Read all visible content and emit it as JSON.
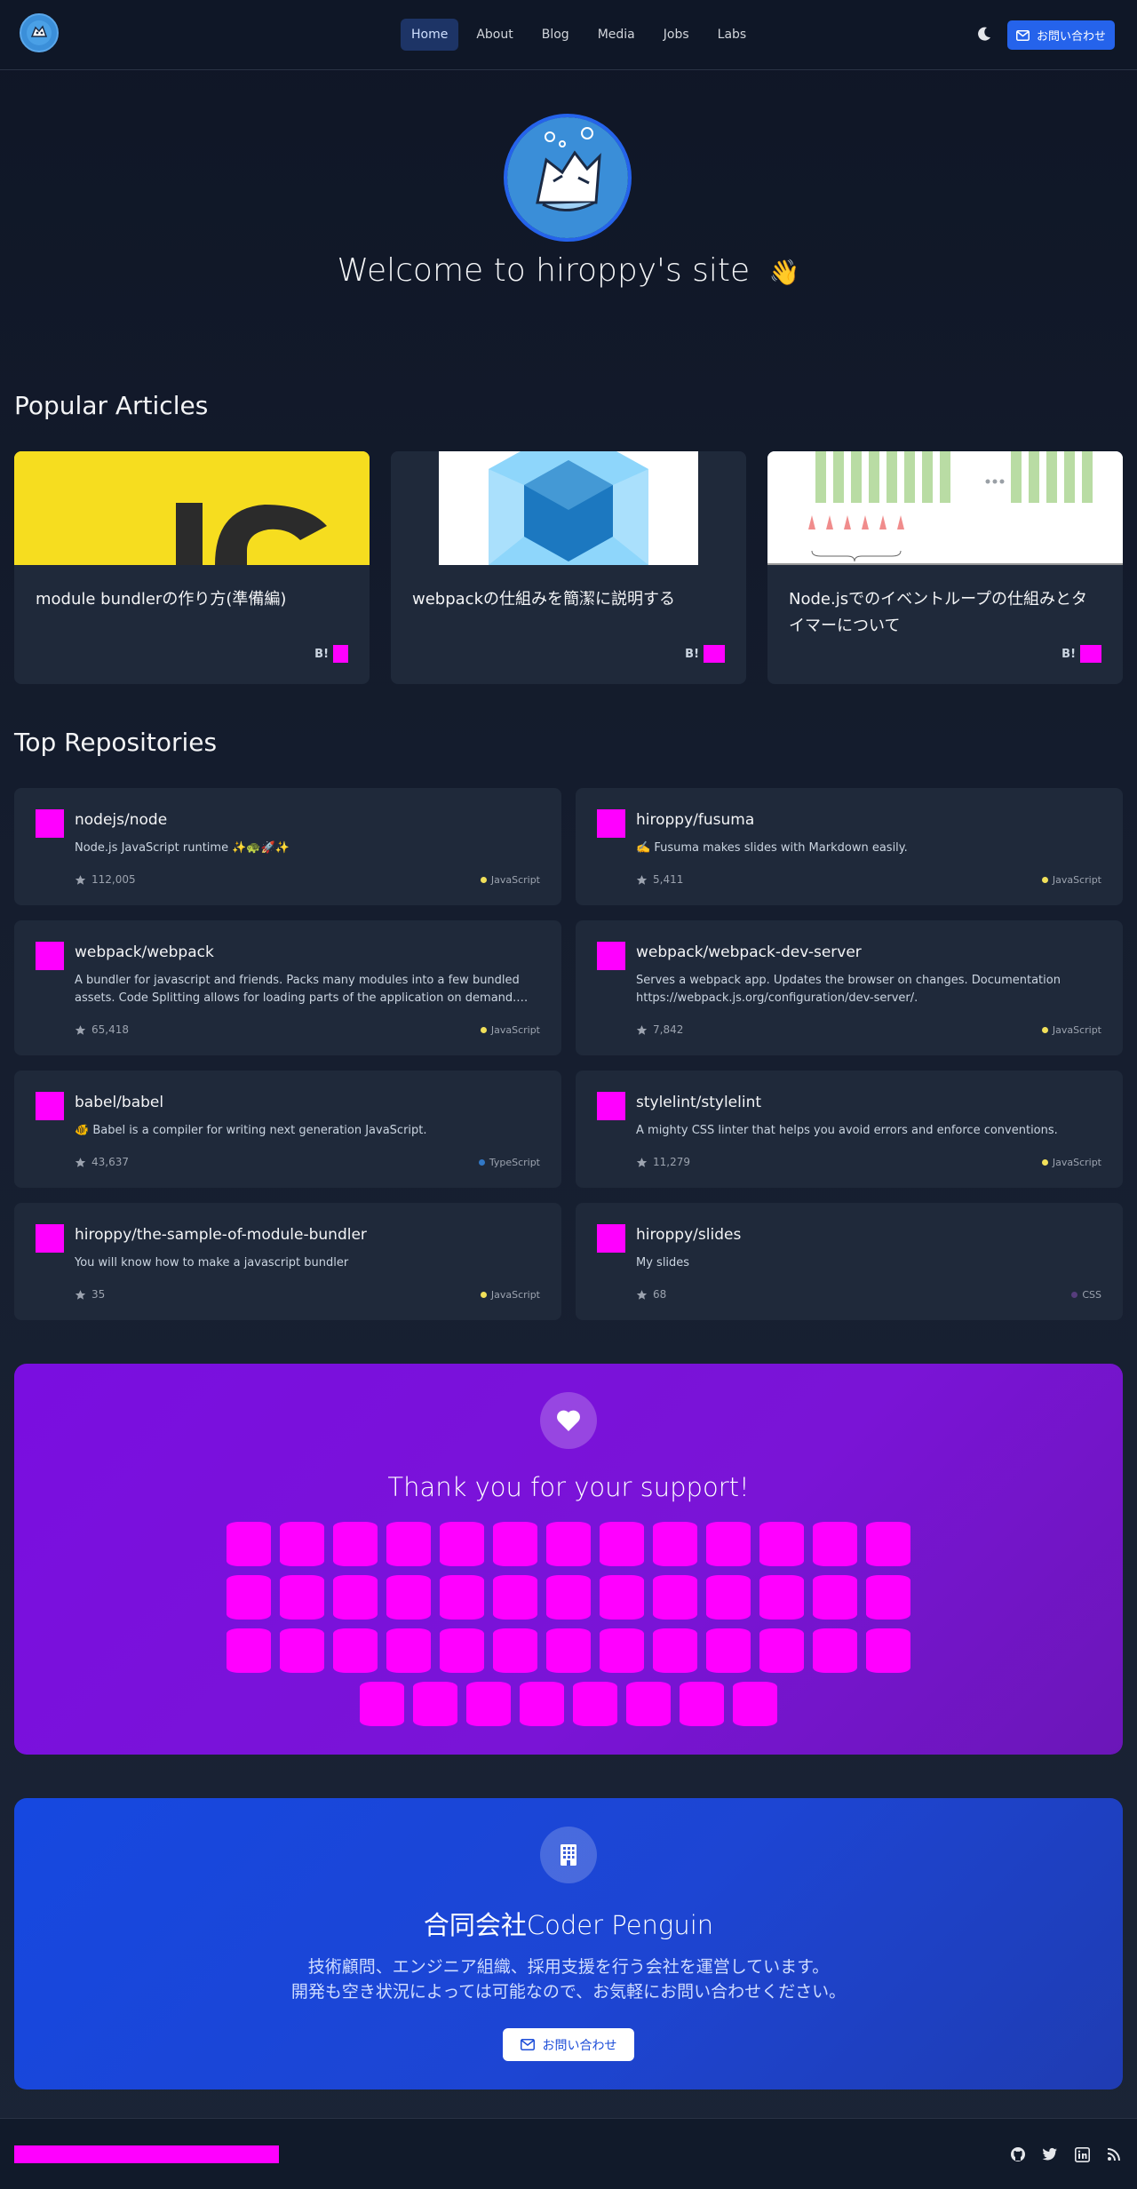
{
  "header": {
    "nav": [
      {
        "label": "Home",
        "active": true
      },
      {
        "label": "About"
      },
      {
        "label": "Blog"
      },
      {
        "label": "Media"
      },
      {
        "label": "Jobs"
      },
      {
        "label": "Labs"
      }
    ],
    "contact_label": "お問い合わせ",
    "icons": {
      "theme": "moon-icon",
      "contact": "mail-icon"
    }
  },
  "hero": {
    "title": "Welcome to hiroppy's site",
    "emoji": "👋"
  },
  "articles": {
    "title": "Popular Articles",
    "items": [
      {
        "title": "module bundlerの作り方(準備編)",
        "badge": "B!"
      },
      {
        "title": "webpackの仕組みを簡潔に説明する",
        "badge": "B!"
      },
      {
        "title": "Node.jsでのイベントループの仕組みとタイマーについて",
        "badge": "B!"
      }
    ]
  },
  "repositories": {
    "title": "Top Repositories",
    "items": [
      {
        "name": "nodejs/node",
        "description": "Node.js JavaScript runtime ✨🐢🚀✨",
        "stars": "112,005",
        "language": "JavaScript",
        "lang_color": "#f1e05a"
      },
      {
        "name": "hiroppy/fusuma",
        "description": "✍️ Fusuma makes slides with Markdown easily.",
        "stars": "5,411",
        "language": "JavaScript",
        "lang_color": "#f1e05a"
      },
      {
        "name": "webpack/webpack",
        "description": "A bundler for javascript and friends. Packs many modules into a few bundled assets. Code Splitting allows for loading parts of the application on demand. Through “loaders”, modules can be CommonJs, AMD, ES6 modules, CSS, Images, JSON, Coffeescript, LESS, ... and your custom stuff.",
        "stars": "65,418",
        "language": "JavaScript",
        "lang_color": "#f1e05a"
      },
      {
        "name": "webpack/webpack-dev-server",
        "description": "Serves a webpack app. Updates the browser on changes. Documentation https://webpack.js.org/configuration/dev-server/.",
        "stars": "7,842",
        "language": "JavaScript",
        "lang_color": "#f1e05a"
      },
      {
        "name": "babel/babel",
        "description": "🐠 Babel is a compiler for writing next generation JavaScript.",
        "stars": "43,637",
        "language": "TypeScript",
        "lang_color": "#3178c6"
      },
      {
        "name": "stylelint/stylelint",
        "description": "A mighty CSS linter that helps you avoid errors and enforce conventions.",
        "stars": "11,279",
        "language": "JavaScript",
        "lang_color": "#f1e05a"
      },
      {
        "name": "hiroppy/the-sample-of-module-bundler",
        "description": "You will know how to make a javascript bundler",
        "stars": "35",
        "language": "JavaScript",
        "lang_color": "#f1e05a"
      },
      {
        "name": "hiroppy/slides",
        "description": "My slides",
        "stars": "68",
        "language": "CSS",
        "lang_color": "#563d7c"
      }
    ]
  },
  "support": {
    "title": "Thank you for your support!",
    "sponsor_rows": [
      13,
      13,
      13,
      8
    ],
    "icon": "heart-icon"
  },
  "company": {
    "title": "合同会社Coder Penguin",
    "description_line1": "技術顧問、エンジニア組織、採用支援を行う会社を運営しています。",
    "description_line2": "開発も空き状況によっては可能なので、お気軽にお問い合わせください。",
    "button_label": "お問い合わせ",
    "icon": "building-icon"
  },
  "footer": {
    "social": [
      "github-icon",
      "twitter-icon",
      "linkedin-icon",
      "rss-icon"
    ]
  }
}
